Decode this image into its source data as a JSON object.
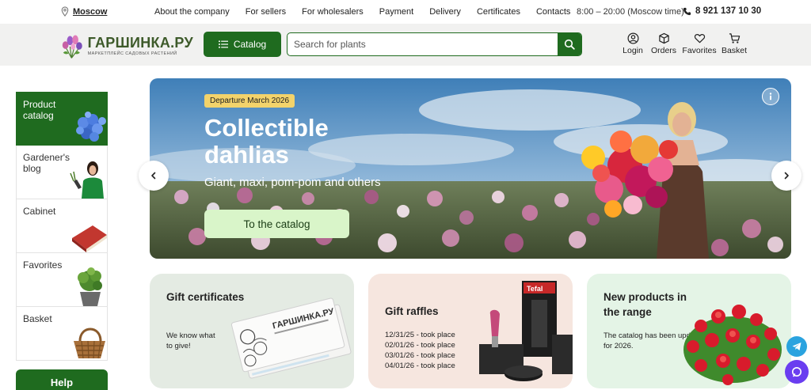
{
  "topbar": {
    "city": "Moscow",
    "nav": [
      "About the company",
      "For sellers",
      "For wholesalers",
      "Payment",
      "Delivery",
      "Certificates",
      "Contacts"
    ],
    "hours": "8:00 – 20:00 (Moscow time)",
    "phone": "8 921 137 10 30"
  },
  "header": {
    "logo_name": "ГАРШИНКА.РУ",
    "logo_tagline": "МАРКЕТПЛЕЙС САДОВЫХ РАСТЕНИЙ",
    "catalog_label": "Catalog",
    "search_placeholder": "Search for plants",
    "actions": {
      "login": "Login",
      "orders": "Orders",
      "favorites": "Favorites",
      "basket": "Basket"
    }
  },
  "sidebar": {
    "items": [
      {
        "label": "Product catalog",
        "icon": "hydrangea-icon",
        "active": true
      },
      {
        "label": "Gardener's blog",
        "icon": "gardener-icon",
        "active": false
      },
      {
        "label": "Cabinet",
        "icon": "book-icon",
        "active": false
      },
      {
        "label": "Favorites",
        "icon": "potted-plant-icon",
        "active": false
      },
      {
        "label": "Basket",
        "icon": "wicker-basket-icon",
        "active": false
      }
    ],
    "help_label": "Help"
  },
  "hero": {
    "badge": "Departure March 2026",
    "title": "Collectible dahlias",
    "subtitle": "Giant, maxi, pom-pom and others",
    "cta": "To the catalog"
  },
  "cards": {
    "gift": {
      "title": "Gift certificates",
      "text": "We know what to give!",
      "card_text": "ГАРШИНКА.РУ"
    },
    "raffle": {
      "title": "Gift raffles",
      "lines": [
        "12/31/25 - took place",
        "02/01/26 - took place",
        "03/01/26 - took place",
        "04/01/26 - took place"
      ],
      "box_brand": "Tefal"
    },
    "newp": {
      "title": "New products in the range",
      "text": "The catalog has been updated for 2026."
    }
  },
  "colors": {
    "brand_green": "#1f6b1f",
    "badge_yellow": "#f3d36b",
    "cta_mint": "#d9f5c9",
    "telegram_blue": "#2aa3df",
    "chat_purple": "#6a3df0"
  }
}
